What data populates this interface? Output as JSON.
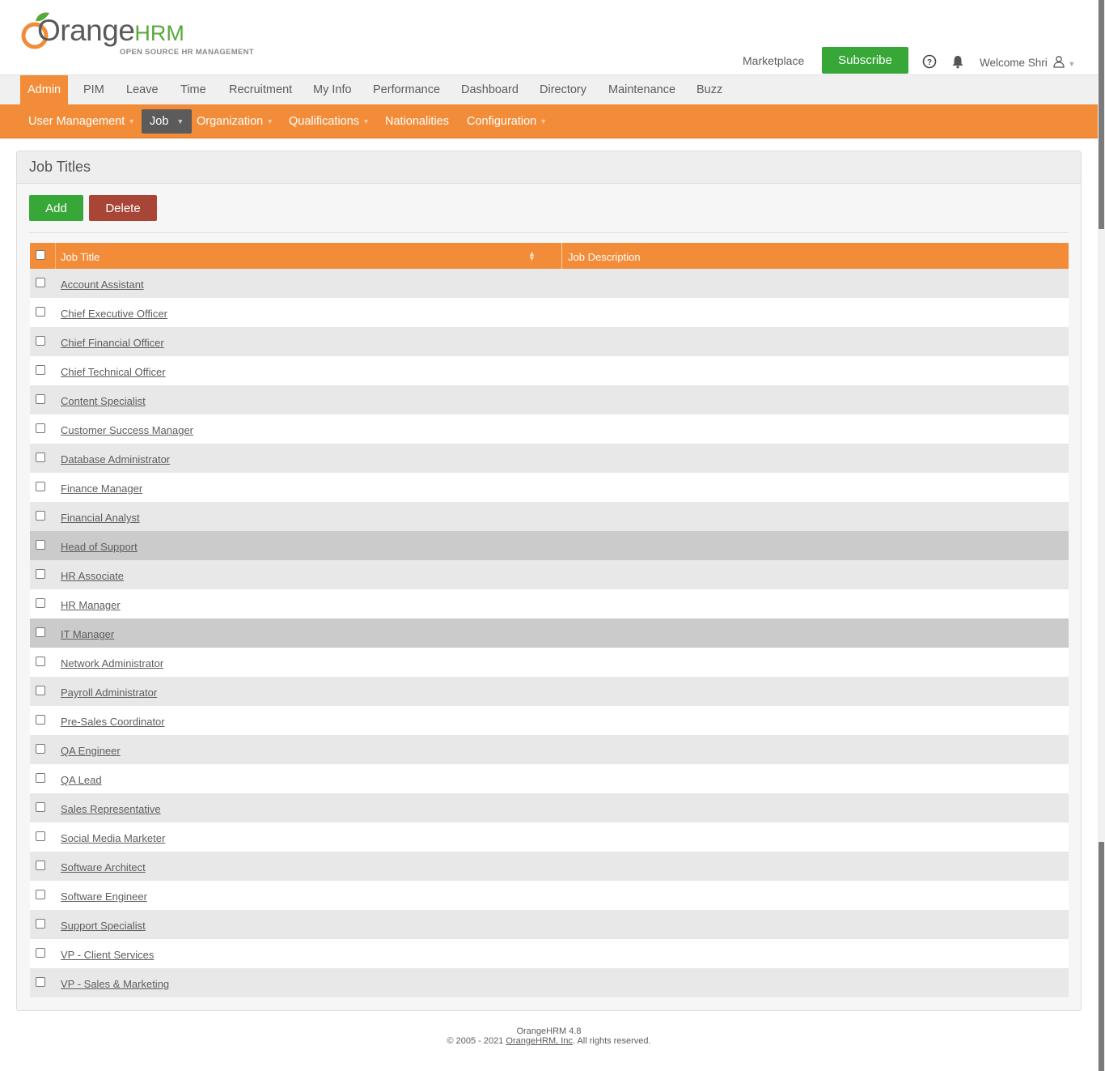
{
  "header": {
    "logo_main": "Orange",
    "logo_hrm": "HRM",
    "logo_tagline": "OPEN SOURCE HR MANAGEMENT",
    "marketplace_label": "Marketplace",
    "subscribe_label": "Subscribe",
    "welcome_text": "Welcome Shri"
  },
  "main_menu": {
    "items": [
      "Admin",
      "PIM",
      "Leave",
      "Time",
      "Recruitment",
      "My Info",
      "Performance",
      "Dashboard",
      "Directory",
      "Maintenance",
      "Buzz"
    ],
    "active": "Admin"
  },
  "sub_menu": {
    "items": [
      "User Management",
      "Job",
      "Organization",
      "Qualifications",
      "Nationalities",
      "Configuration"
    ],
    "active": "Job"
  },
  "panel": {
    "title": "Job Titles",
    "add_label": "Add",
    "delete_label": "Delete"
  },
  "table": {
    "columns": [
      "Job Title",
      "Job Description"
    ],
    "rows": [
      "Account Assistant",
      "Chief Executive Officer",
      "Chief Financial Officer",
      "Chief Technical Officer",
      "Content Specialist",
      "Customer Success Manager",
      "Database Administrator",
      "Finance Manager",
      "Financial Analyst",
      "Head of Support",
      "HR Associate",
      "HR Manager",
      "IT Manager",
      "Network Administrator",
      "Payroll Administrator",
      "Pre-Sales Coordinator",
      "QA Engineer",
      "QA Lead",
      "Sales Representative",
      "Social Media Marketer",
      "Software Architect",
      "Software Engineer",
      "Support Specialist",
      "VP - Client Services",
      "VP - Sales & Marketing"
    ]
  },
  "footer": {
    "version": "OrangeHRM 4.8",
    "copyright_prefix": "© 2005 - 2021 ",
    "company_link": "OrangeHRM, Inc",
    "copyright_suffix": ". All rights reserved."
  },
  "colors": {
    "brand_orange": "#f28c38",
    "brand_green": "#37a738",
    "delete_red": "#a94536"
  }
}
